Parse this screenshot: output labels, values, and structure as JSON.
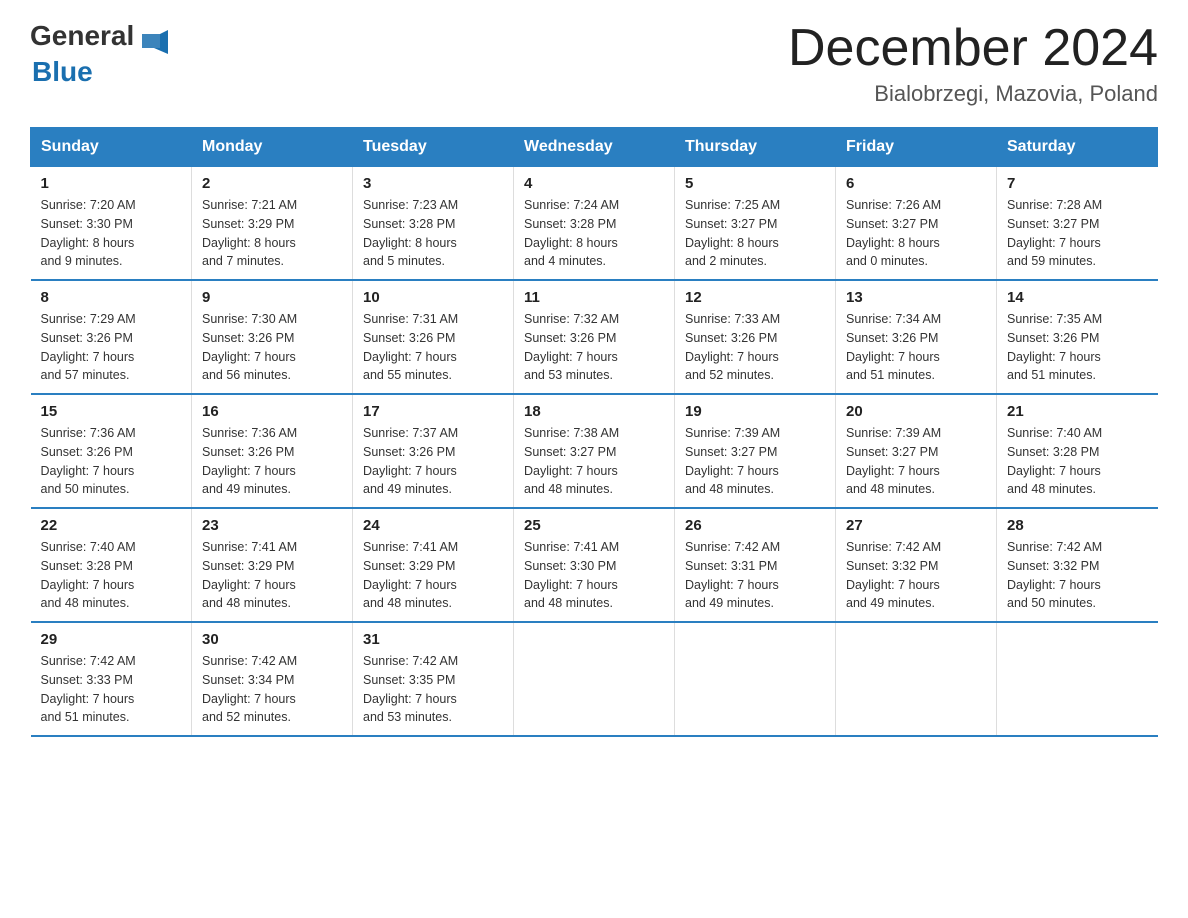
{
  "header": {
    "logo": {
      "general": "General",
      "blue": "Blue"
    },
    "title": "December 2024",
    "subtitle": "Bialobrzegi, Mazovia, Poland"
  },
  "weekdays": [
    "Sunday",
    "Monday",
    "Tuesday",
    "Wednesday",
    "Thursday",
    "Friday",
    "Saturday"
  ],
  "weeks": [
    [
      {
        "day": "1",
        "sunrise": "7:20 AM",
        "sunset": "3:30 PM",
        "daylight": "8 hours and 9 minutes."
      },
      {
        "day": "2",
        "sunrise": "7:21 AM",
        "sunset": "3:29 PM",
        "daylight": "8 hours and 7 minutes."
      },
      {
        "day": "3",
        "sunrise": "7:23 AM",
        "sunset": "3:28 PM",
        "daylight": "8 hours and 5 minutes."
      },
      {
        "day": "4",
        "sunrise": "7:24 AM",
        "sunset": "3:28 PM",
        "daylight": "8 hours and 4 minutes."
      },
      {
        "day": "5",
        "sunrise": "7:25 AM",
        "sunset": "3:27 PM",
        "daylight": "8 hours and 2 minutes."
      },
      {
        "day": "6",
        "sunrise": "7:26 AM",
        "sunset": "3:27 PM",
        "daylight": "8 hours and 0 minutes."
      },
      {
        "day": "7",
        "sunrise": "7:28 AM",
        "sunset": "3:27 PM",
        "daylight": "7 hours and 59 minutes."
      }
    ],
    [
      {
        "day": "8",
        "sunrise": "7:29 AM",
        "sunset": "3:26 PM",
        "daylight": "7 hours and 57 minutes."
      },
      {
        "day": "9",
        "sunrise": "7:30 AM",
        "sunset": "3:26 PM",
        "daylight": "7 hours and 56 minutes."
      },
      {
        "day": "10",
        "sunrise": "7:31 AM",
        "sunset": "3:26 PM",
        "daylight": "7 hours and 55 minutes."
      },
      {
        "day": "11",
        "sunrise": "7:32 AM",
        "sunset": "3:26 PM",
        "daylight": "7 hours and 53 minutes."
      },
      {
        "day": "12",
        "sunrise": "7:33 AM",
        "sunset": "3:26 PM",
        "daylight": "7 hours and 52 minutes."
      },
      {
        "day": "13",
        "sunrise": "7:34 AM",
        "sunset": "3:26 PM",
        "daylight": "7 hours and 51 minutes."
      },
      {
        "day": "14",
        "sunrise": "7:35 AM",
        "sunset": "3:26 PM",
        "daylight": "7 hours and 51 minutes."
      }
    ],
    [
      {
        "day": "15",
        "sunrise": "7:36 AM",
        "sunset": "3:26 PM",
        "daylight": "7 hours and 50 minutes."
      },
      {
        "day": "16",
        "sunrise": "7:36 AM",
        "sunset": "3:26 PM",
        "daylight": "7 hours and 49 minutes."
      },
      {
        "day": "17",
        "sunrise": "7:37 AM",
        "sunset": "3:26 PM",
        "daylight": "7 hours and 49 minutes."
      },
      {
        "day": "18",
        "sunrise": "7:38 AM",
        "sunset": "3:27 PM",
        "daylight": "7 hours and 48 minutes."
      },
      {
        "day": "19",
        "sunrise": "7:39 AM",
        "sunset": "3:27 PM",
        "daylight": "7 hours and 48 minutes."
      },
      {
        "day": "20",
        "sunrise": "7:39 AM",
        "sunset": "3:27 PM",
        "daylight": "7 hours and 48 minutes."
      },
      {
        "day": "21",
        "sunrise": "7:40 AM",
        "sunset": "3:28 PM",
        "daylight": "7 hours and 48 minutes."
      }
    ],
    [
      {
        "day": "22",
        "sunrise": "7:40 AM",
        "sunset": "3:28 PM",
        "daylight": "7 hours and 48 minutes."
      },
      {
        "day": "23",
        "sunrise": "7:41 AM",
        "sunset": "3:29 PM",
        "daylight": "7 hours and 48 minutes."
      },
      {
        "day": "24",
        "sunrise": "7:41 AM",
        "sunset": "3:29 PM",
        "daylight": "7 hours and 48 minutes."
      },
      {
        "day": "25",
        "sunrise": "7:41 AM",
        "sunset": "3:30 PM",
        "daylight": "7 hours and 48 minutes."
      },
      {
        "day": "26",
        "sunrise": "7:42 AM",
        "sunset": "3:31 PM",
        "daylight": "7 hours and 49 minutes."
      },
      {
        "day": "27",
        "sunrise": "7:42 AM",
        "sunset": "3:32 PM",
        "daylight": "7 hours and 49 minutes."
      },
      {
        "day": "28",
        "sunrise": "7:42 AM",
        "sunset": "3:32 PM",
        "daylight": "7 hours and 50 minutes."
      }
    ],
    [
      {
        "day": "29",
        "sunrise": "7:42 AM",
        "sunset": "3:33 PM",
        "daylight": "7 hours and 51 minutes."
      },
      {
        "day": "30",
        "sunrise": "7:42 AM",
        "sunset": "3:34 PM",
        "daylight": "7 hours and 52 minutes."
      },
      {
        "day": "31",
        "sunrise": "7:42 AM",
        "sunset": "3:35 PM",
        "daylight": "7 hours and 53 minutes."
      },
      null,
      null,
      null,
      null
    ]
  ],
  "labels": {
    "sunrise": "Sunrise:",
    "sunset": "Sunset:",
    "daylight": "Daylight:"
  }
}
